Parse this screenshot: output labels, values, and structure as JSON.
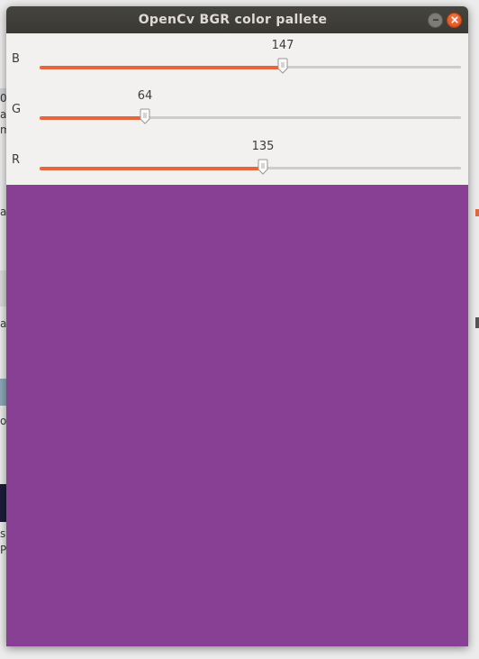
{
  "window": {
    "title": "OpenCv BGR color pallete"
  },
  "trackbars": [
    {
      "label": "B",
      "value": 147,
      "max": 255
    },
    {
      "label": "G",
      "value": 64,
      "max": 255
    },
    {
      "label": "R",
      "value": 135,
      "max": 255
    }
  ],
  "swatch": {
    "color": "#874093"
  },
  "colors": {
    "slider_fill": "#e8643a",
    "close_button": "#dd4814",
    "titlebar": "#3f3e39"
  },
  "background_fragments": [
    "0",
    "a",
    "m",
    "ai",
    "a",
    "ol",
    "s",
    "P"
  ]
}
